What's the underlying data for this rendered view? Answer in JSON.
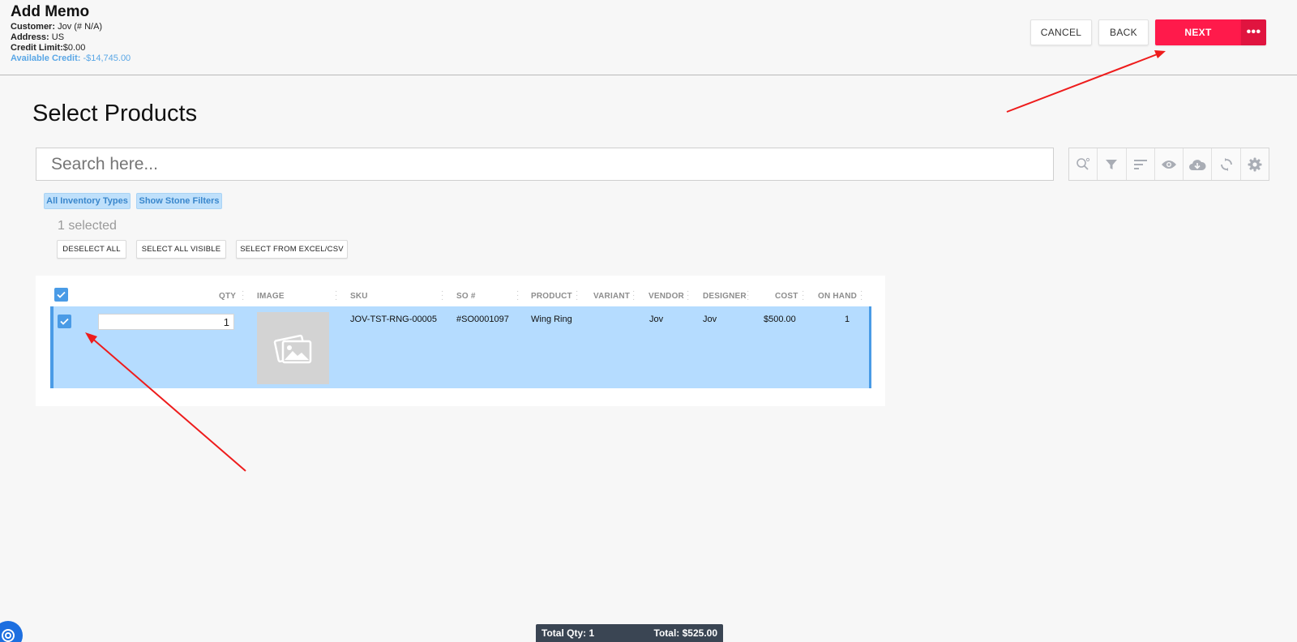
{
  "header": {
    "title": "Add Memo",
    "customer_label": "Customer:",
    "customer_value": " Jov (# N/A)",
    "address_label": "Address:",
    "address_value": " US",
    "credit_limit_label": "Credit Limit:",
    "credit_limit_value": "$0.00",
    "available_credit_label": "Available Credit:",
    "available_credit_value": " -$14,745.00",
    "buttons": {
      "cancel": "CANCEL",
      "back": "BACK",
      "next": "NEXT",
      "more": "•••"
    }
  },
  "section": {
    "title": "Select Products",
    "search_placeholder": "Search here...",
    "toolbar_icons": [
      "search-settings-icon",
      "filter-icon",
      "sort-icon",
      "eye-icon",
      "cloud-download-icon",
      "refresh-icon",
      "gear-icon"
    ],
    "chips": [
      "All Inventory Types",
      "Show Stone Filters"
    ],
    "selected_count": "1 selected",
    "selection_buttons": [
      "DESELECT ALL",
      "SELECT ALL VISIBLE",
      "SELECT FROM EXCEL/CSV"
    ]
  },
  "grid": {
    "columns": [
      "QTY",
      "IMAGE",
      "SKU",
      "SO #",
      "PRODUCT",
      "VARIANT",
      "VENDOR",
      "DESIGNER",
      "COST",
      "ON HAND"
    ],
    "rows": [
      {
        "selected": true,
        "qty": "1",
        "sku": "JOV-TST-RNG-00005",
        "so": "#SO0001097",
        "product": "Wing Ring",
        "variant": "",
        "vendor": "Jov",
        "designer": "Jov",
        "cost": "$500.00",
        "on_hand": "1"
      }
    ]
  },
  "footer": {
    "total_qty": "Total Qty: 1",
    "total": "Total: $525.00"
  },
  "colors": {
    "primary_red": "#ff1a4b",
    "selection_blue": "#b5dcff",
    "accent_blue": "#4a9be6",
    "annotation_red": "#ff0000"
  }
}
